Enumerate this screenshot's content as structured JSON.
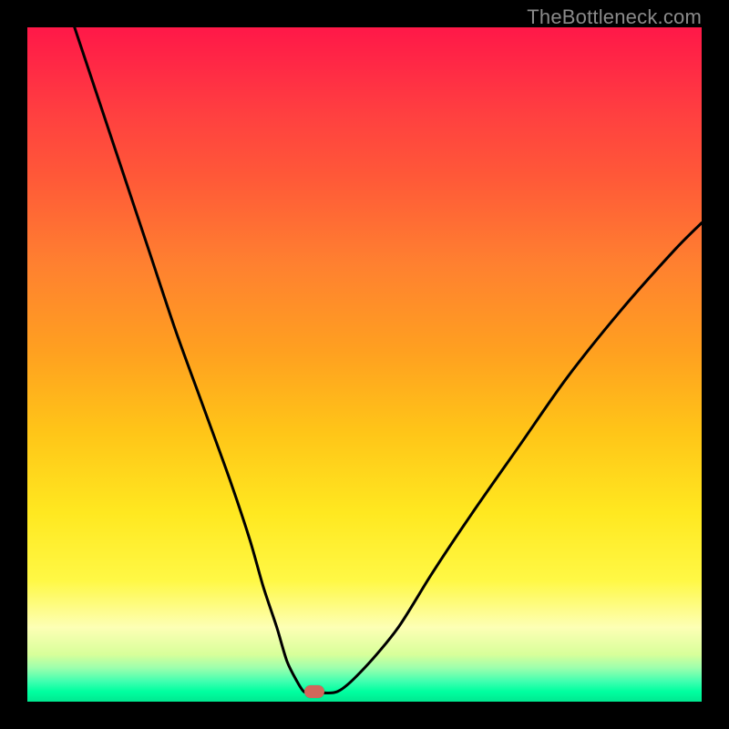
{
  "watermark": "TheBottleneck.com",
  "chart_data": {
    "type": "line",
    "title": "",
    "xlabel": "",
    "ylabel": "",
    "xlim": [
      0,
      100
    ],
    "ylim": [
      0,
      100
    ],
    "background_gradient": {
      "top": "#ff1848",
      "bottom": "#00e890"
    },
    "series": [
      {
        "name": "bottleneck-curve",
        "color": "#000000",
        "x": [
          7,
          10,
          14,
          18,
          22,
          26,
          30,
          33,
          35,
          37,
          38.5,
          40,
          41,
          42,
          46,
          50,
          55,
          60,
          66,
          73,
          80,
          88,
          96,
          100
        ],
        "y": [
          100,
          91,
          79,
          67,
          55,
          44,
          33,
          24,
          17,
          11,
          6,
          3,
          1.5,
          1.5,
          1.5,
          5,
          11,
          19,
          28,
          38,
          48,
          58,
          67,
          71
        ]
      }
    ],
    "marker": {
      "name": "sweet-spot",
      "x": 42.5,
      "y": 1.5,
      "color": "#d2675b"
    }
  }
}
